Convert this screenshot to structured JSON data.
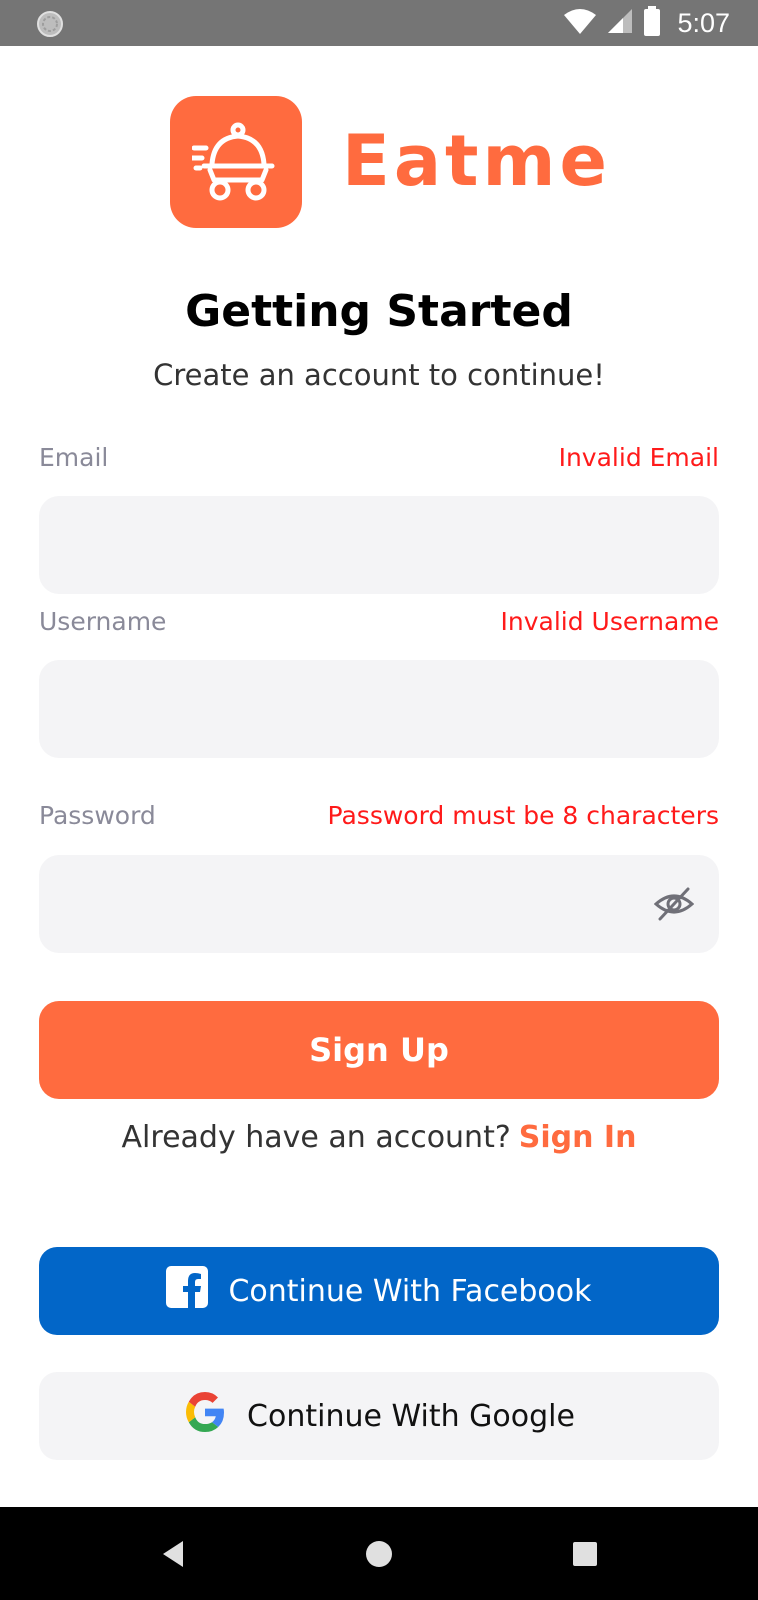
{
  "status_bar": {
    "time": "5:07",
    "icons": [
      "notification-icon",
      "wifi-icon",
      "cell-signal-icon",
      "battery-icon"
    ]
  },
  "brand": {
    "name": "Eatme",
    "logo_icon": "food-delivery-cloche-icon",
    "accent_color": "#ff6b3f"
  },
  "header": {
    "title": "Getting Started",
    "subtitle": "Create an account to continue!"
  },
  "form": {
    "email": {
      "label": "Email",
      "error": "Invalid Email",
      "value": ""
    },
    "username": {
      "label": "Username",
      "error": "Invalid Username",
      "value": ""
    },
    "password": {
      "label": "Password",
      "error": "Password must be 8 characters",
      "value": "",
      "toggle_icon": "eye-off-icon"
    },
    "error_color": "#ff1a1a"
  },
  "actions": {
    "signup_label": "Sign Up",
    "signin_prompt": "Already have an account?",
    "signin_label": "Sign In"
  },
  "social": {
    "facebook_label": "Continue With Facebook",
    "facebook_color": "#0266c8",
    "google_label": "Continue With Google"
  },
  "nav_bar": {
    "icons": [
      "back-icon",
      "home-icon",
      "recents-icon"
    ]
  }
}
